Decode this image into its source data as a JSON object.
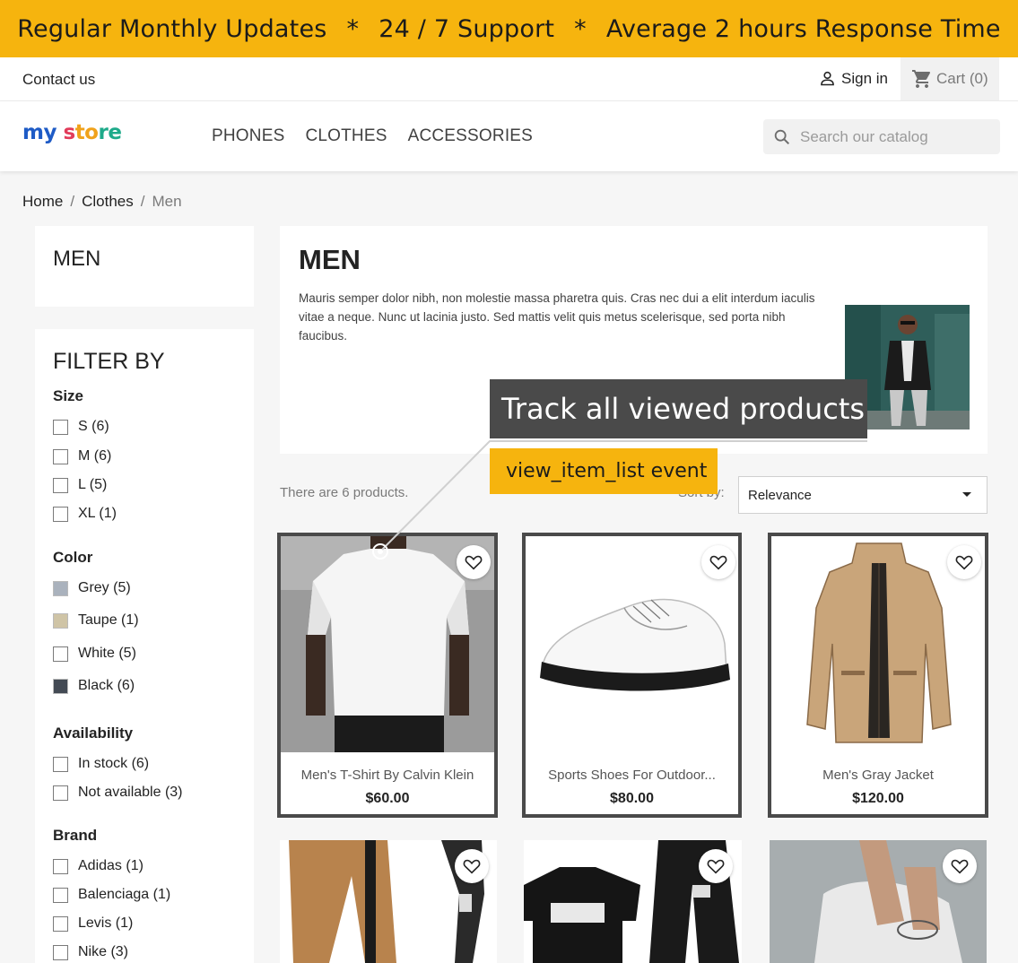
{
  "promo": {
    "item1": "Regular Monthly Updates",
    "sep": "*",
    "item2": "24 / 7 Support",
    "item3": "Average 2 hours Response Time"
  },
  "topnav": {
    "contact": "Contact us",
    "signin": "Sign in",
    "cart": "Cart (0)"
  },
  "header": {
    "logo": {
      "part1": "my",
      "part2": "s",
      "part3": "to",
      "part4": "re"
    },
    "menu": [
      "PHONES",
      "CLOTHES",
      "ACCESSORIES"
    ],
    "search_placeholder": "Search our catalog"
  },
  "breadcrumb": {
    "home": "Home",
    "clothes": "Clothes",
    "current": "Men",
    "divider": "/"
  },
  "sidebar": {
    "category_title": "MEN",
    "filter_title": "FILTER BY",
    "groups": {
      "size": {
        "title": "Size",
        "items": [
          "S (6)",
          "M (6)",
          "L (5)",
          "XL (1)"
        ]
      },
      "color": {
        "title": "Color",
        "items": [
          {
            "label": "Grey (5)",
            "color": "#aab2bd"
          },
          {
            "label": "Taupe (1)",
            "color": "#cfc4a6"
          },
          {
            "label": "White (5)",
            "color": "#ffffff"
          },
          {
            "label": "Black (6)",
            "color": "#434a54"
          }
        ]
      },
      "availability": {
        "title": "Availability",
        "items": [
          "In stock (6)",
          "Not available (3)"
        ]
      },
      "brand": {
        "title": "Brand",
        "items": [
          "Adidas (1)",
          "Balenciaga (1)",
          "Levis (1)",
          "Nike (3)"
        ]
      }
    }
  },
  "main": {
    "title": "MEN",
    "description": "Mauris semper dolor nibh, non molestie massa pharetra quis. Cras nec dui a elit interdum iaculis vitae a neque. Nunc ut lacinia justo. Sed mattis velit quis metus scelerisque, sed porta nibh faucibus.",
    "product_count": "There are 6 products.",
    "sort_label": "Sort by:",
    "sort_value": "Relevance"
  },
  "products": [
    {
      "name": "Men's T-Shirt By Calvin Klein",
      "price": "$60.00"
    },
    {
      "name": "Sports Shoes For Outdoor...",
      "price": "$80.00"
    },
    {
      "name": "Men's Gray Jacket",
      "price": "$120.00"
    }
  ],
  "annotation": {
    "callout": "Track all viewed products",
    "tag": "view_item_list event"
  },
  "colors": {
    "banner": "#f6b40e",
    "highlight_border": "#4a4a4a",
    "callout_bg": "#4a4a4a"
  }
}
